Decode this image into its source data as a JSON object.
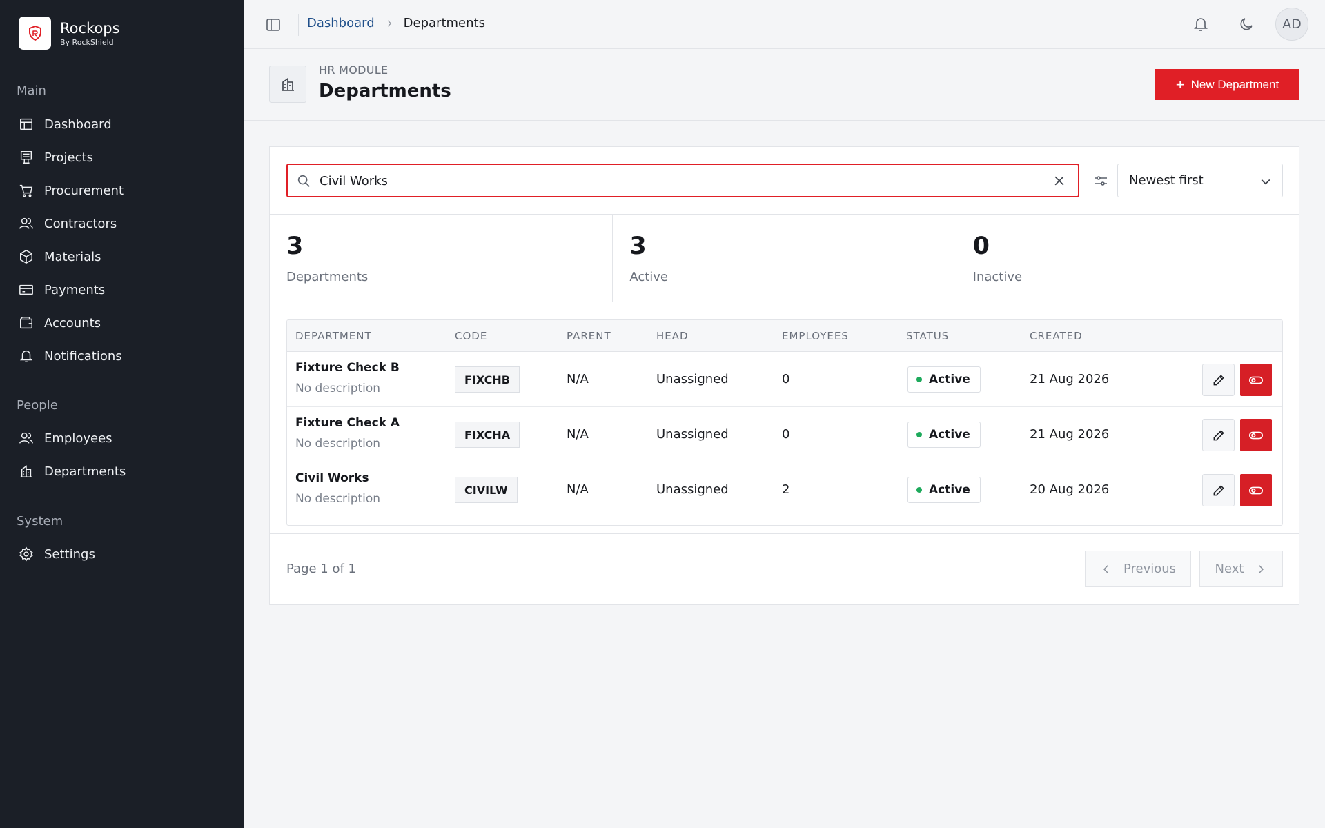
{
  "brand": {
    "name": "Rockops",
    "subtitle": "By RockShield",
    "accent": "#e01f26"
  },
  "sidebar": {
    "sections": [
      {
        "label": "Main"
      },
      {
        "label": "People"
      },
      {
        "label": "System"
      }
    ],
    "items": [
      {
        "label": "Dashboard",
        "icon": "dashboard-icon"
      },
      {
        "label": "Projects",
        "icon": "projects-icon"
      },
      {
        "label": "Procurement",
        "icon": "cart-icon"
      },
      {
        "label": "Contractors",
        "icon": "contractors-icon"
      },
      {
        "label": "Materials",
        "icon": "box-icon"
      },
      {
        "label": "Payments",
        "icon": "card-icon"
      },
      {
        "label": "Accounts",
        "icon": "wallet-icon"
      },
      {
        "label": "Notifications",
        "icon": "bell-icon"
      },
      {
        "label": "Employees",
        "icon": "users-icon"
      },
      {
        "label": "Departments",
        "icon": "building-icon"
      },
      {
        "label": "Settings",
        "icon": "gear-icon"
      }
    ]
  },
  "topbar": {
    "breadcrumb": {
      "root": "Dashboard",
      "current": "Departments"
    },
    "avatar_initials": "AD"
  },
  "header": {
    "module_label": "HR MODULE",
    "title": "Departments",
    "new_button_label": "New Department"
  },
  "search": {
    "value": "Civil Works",
    "placeholder": "Search departments"
  },
  "sort": {
    "selected": "Newest first"
  },
  "stats": [
    {
      "value": "3",
      "label": "Departments"
    },
    {
      "value": "3",
      "label": "Active"
    },
    {
      "value": "0",
      "label": "Inactive"
    }
  ],
  "table": {
    "columns": [
      "DEPARTMENT",
      "CODE",
      "PARENT",
      "HEAD",
      "EMPLOYEES",
      "STATUS",
      "CREATED"
    ],
    "rows": [
      {
        "name": "Fixture Check B",
        "description": "No description",
        "code": "FIXCHB",
        "parent": "N/A",
        "head": "Unassigned",
        "employees": "0",
        "status": "Active",
        "created": "21 Aug 2026"
      },
      {
        "name": "Fixture Check A",
        "description": "No description",
        "code": "FIXCHA",
        "parent": "N/A",
        "head": "Unassigned",
        "employees": "0",
        "status": "Active",
        "created": "21 Aug 2026"
      },
      {
        "name": "Civil Works",
        "description": "No description",
        "code": "CIVILW",
        "parent": "N/A",
        "head": "Unassigned",
        "employees": "2",
        "status": "Active",
        "created": "20 Aug 2026"
      }
    ]
  },
  "pagination": {
    "info": "Page 1 of 1",
    "previous_label": "Previous",
    "next_label": "Next"
  }
}
